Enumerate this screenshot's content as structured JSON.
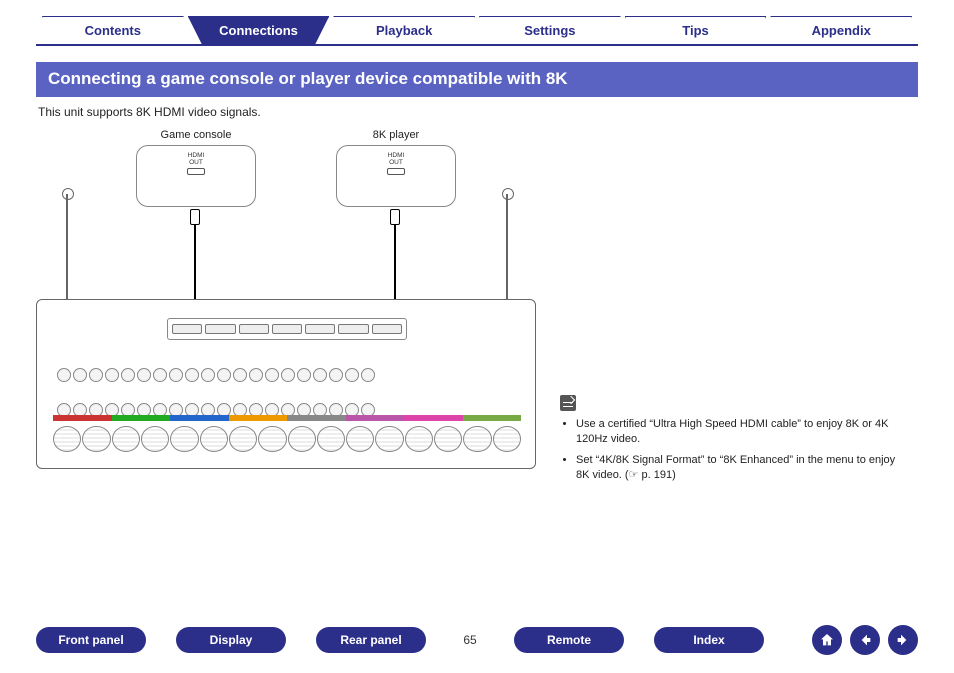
{
  "tabs": {
    "items": [
      {
        "label": "Contents",
        "active": false
      },
      {
        "label": "Connections",
        "active": true
      },
      {
        "label": "Playback",
        "active": false
      },
      {
        "label": "Settings",
        "active": false
      },
      {
        "label": "Tips",
        "active": false
      },
      {
        "label": "Appendix",
        "active": false
      }
    ]
  },
  "heading": "Connecting a game console or player device compatible with 8K",
  "subtitle": "This unit supports 8K HDMI video signals.",
  "diagram": {
    "device1_label": "Game console",
    "device2_label": "8K player",
    "hdmi_out_line1": "HDMI",
    "hdmi_out_line2": "OUT"
  },
  "notes": {
    "items": [
      "Use a certified “Ultra High Speed HDMI cable” to enjoy 8K or 4K 120Hz video.",
      "Set “4K/8K Signal Format” to “8K Enhanced” in the menu to enjoy 8K video.  (☞ p. 191)"
    ]
  },
  "bottom_nav": {
    "items": [
      "Front panel",
      "Display",
      "Rear panel"
    ],
    "page": "65",
    "items2": [
      "Remote",
      "Index"
    ]
  },
  "colors": {
    "speaker_strip": [
      "#c33",
      "#c33",
      "#2a2",
      "#2a2",
      "#26c",
      "#26c",
      "#e90",
      "#e90",
      "#888",
      "#888",
      "#b5a",
      "#b5a",
      "#d4a",
      "#d4a",
      "#7a4",
      "#7a4"
    ]
  }
}
